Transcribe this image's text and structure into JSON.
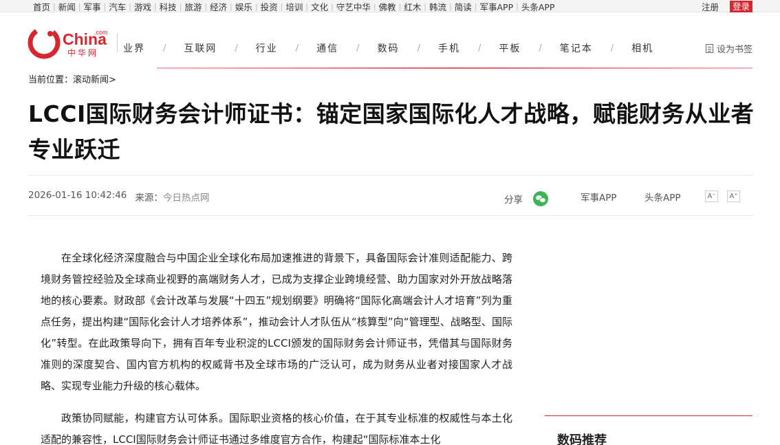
{
  "top_nav": [
    "首页",
    "新闻",
    "军事",
    "汽车",
    "游戏",
    "科技",
    "旅游",
    "经济",
    "娱乐",
    "投资",
    "培训",
    "文化",
    "守艺中华",
    "佛教",
    "红木",
    "韩流",
    "简读",
    "军事APP",
    "头条APP"
  ],
  "auth": {
    "register": "注册",
    "login": "登录"
  },
  "logo": {
    "text": "China",
    "sub": "中华网",
    "com": ".com"
  },
  "main_nav": [
    "业界",
    "互联网",
    "行业",
    "通信",
    "数码",
    "手机",
    "平板",
    "笔记本",
    "相机"
  ],
  "bookmark_label": "设为书签",
  "breadcrumb": {
    "prefix": "当前位置：",
    "link": "滚动新闻",
    "suffix": ">"
  },
  "article": {
    "title": "LCCI国际财务会计师证书：锚定国家国际化人才战略，赋能财务从业者专业跃迁",
    "datetime": "2026-01-16 10:42:46",
    "source_label": "来源：",
    "source": "今日热点网",
    "share_label": "分享",
    "app_links": [
      "军事APP",
      "头条APP"
    ],
    "font_small": "A⁻",
    "font_large": "A⁺",
    "paragraphs": [
      "在全球化经济深度融合与中国企业全球化布局加速推进的背景下，具备国际会计准则适配能力、跨境财务管控经验及全球商业视野的高端财务人才，已成为支撑企业跨境经营、助力国家对外开放战略落地的核心要素。财政部《会计改革与发展“十四五”规划纲要》明确将“国际化高端会计人才培育”列为重点任务，提出构建“国际化会计人才培养体系”，推动会计人才队伍从“核算型”向“管理型、战略型、国际化”转型。在此政策导向下，拥有百年专业积淀的LCCI颁发的国际财务会计师证书，凭借其与国际财务准则的深度契合、国内官方机构的权威背书及全球市场的广泛认可，成为财务从业者对接国家人才战略、实现专业能力升级的核心载体。",
      "政策协同赋能，构建官方认可体系。国际职业资格的核心价值，在于其专业标准的权威性与本土化适配的兼容性，LCCI国际财务会计师证书通过多维度官方合作，构建起“国际标准本土化"
    ]
  },
  "side": {
    "title": "数码推荐"
  },
  "colors": {
    "brand_red": "#d8262f",
    "wechat_green": "#3cb451"
  }
}
